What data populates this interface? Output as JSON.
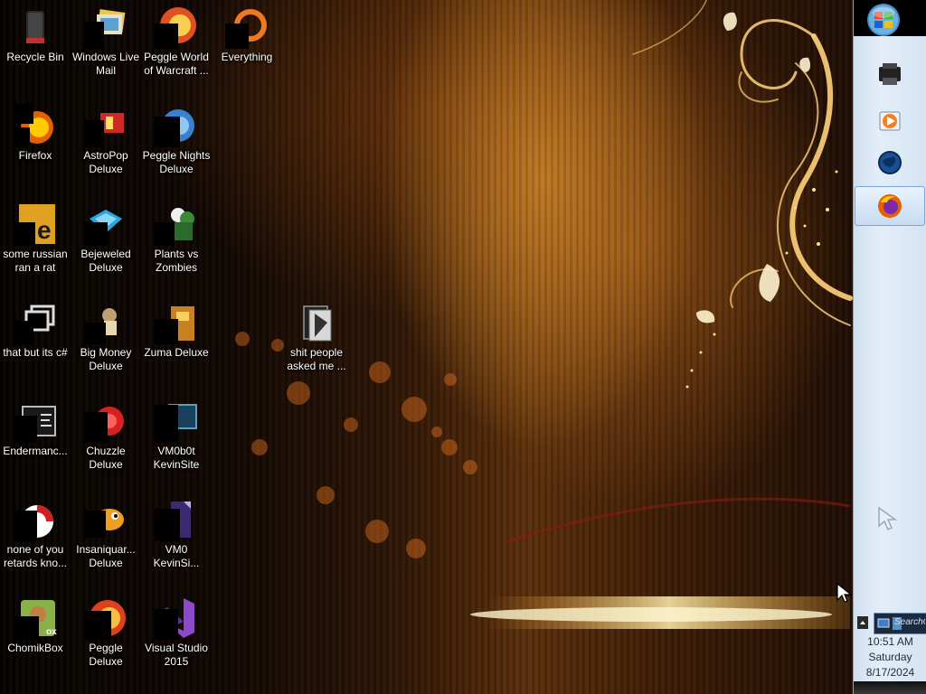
{
  "desktop": {
    "icons": [
      {
        "label": "Recycle Bin"
      },
      {
        "label": "Windows Live Mail"
      },
      {
        "label": "Peggle World of Warcraft ..."
      },
      {
        "label": "Everything"
      },
      {
        "label": "Firefox"
      },
      {
        "label": "AstroPop Deluxe"
      },
      {
        "label": "Peggle Nights Deluxe"
      },
      {
        "label": "some russian ran a rat"
      },
      {
        "label": "Bejeweled Deluxe"
      },
      {
        "label": "Plants vs Zombies"
      },
      {
        "label": "that but its c#"
      },
      {
        "label": "Big Money Deluxe"
      },
      {
        "label": "Zuma Deluxe"
      },
      {
        "label": "shit people asked me ..."
      },
      {
        "label": "Endermanc..."
      },
      {
        "label": "Chuzzle Deluxe"
      },
      {
        "label": "VM0b0t KevinSite"
      },
      {
        "label": "none of you retards kno..."
      },
      {
        "label": "Insaniquar... Deluxe"
      },
      {
        "label": "VM0 KevinSi..."
      },
      {
        "label": "ChomikBox"
      },
      {
        "label": "Peggle Deluxe"
      },
      {
        "label": "Visual Studio 2015"
      }
    ]
  },
  "taskbar": {
    "tray_search_text": "SearchCo",
    "clock": {
      "time": "10:51 AM",
      "day": "Saturday",
      "date": "8/17/2024"
    }
  },
  "colors": {
    "taskbar_bg": "#dbe7f5",
    "taskbar_border": "#8aa5c4",
    "label_text": "#ffffff"
  }
}
